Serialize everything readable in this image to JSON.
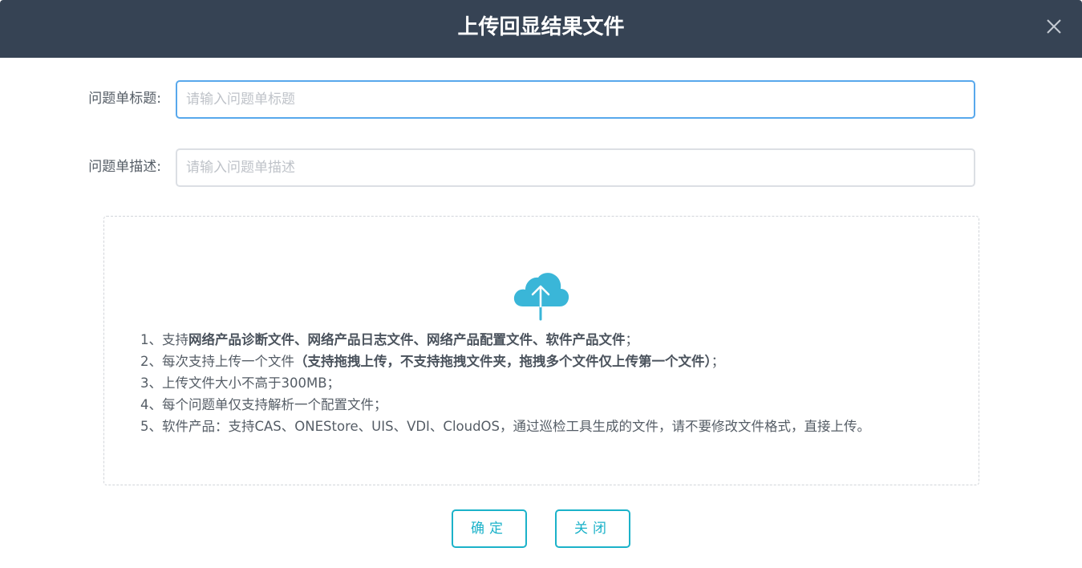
{
  "dialog": {
    "title": "上传回显结果文件",
    "close_icon": "close-icon"
  },
  "form": {
    "title_label": "问题单标题:",
    "title_placeholder": "请输入问题单标题",
    "title_value": "",
    "desc_label": "问题单描述:",
    "desc_placeholder": "请输入问题单描述",
    "desc_value": ""
  },
  "upload": {
    "icon": "cloud-upload-icon",
    "icon_color": "#3ab6d8",
    "rules": [
      {
        "prefix": "1、支持",
        "bold": "网络产品诊断文件、网络产品日志文件、网络产品配置文件、软件产品文件",
        "suffix": "；"
      },
      {
        "prefix": "2、每次支持上传一个文件",
        "bold": "（支持拖拽上传，不支持拖拽文件夹，拖拽多个文件仅上传第一个文件）",
        "suffix": "；"
      },
      {
        "prefix": "3、上传文件大小不高于300MB；",
        "bold": "",
        "suffix": ""
      },
      {
        "prefix": "4、每个问题单仅支持解析一个配置文件；",
        "bold": "",
        "suffix": ""
      },
      {
        "prefix": "5、软件产品：支持CAS、ONEStore、UIS、VDI、CloudOS，通过巡检工具生成的文件，请不要修改文件格式，直接上传。",
        "bold": "",
        "suffix": ""
      }
    ]
  },
  "buttons": {
    "confirm_label": "确定",
    "close_label": "关闭"
  },
  "colors": {
    "header_bg": "#364354",
    "accent": "#1bb2c9",
    "focus_border": "#58a8ec"
  }
}
